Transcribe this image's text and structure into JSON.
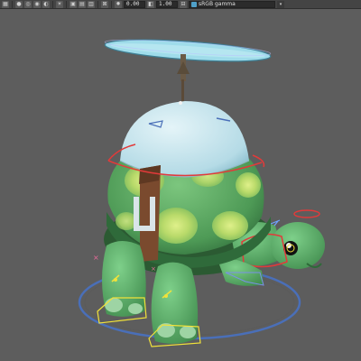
{
  "toolbar": {
    "icons": [
      "grid-icon",
      "camera-icon",
      "wireframe-icon",
      "shaded-icon",
      "textured-icon",
      "light-icon",
      "shadow-icon",
      "xray-icon",
      "isolate-icon",
      "gate-icon"
    ],
    "exposure_icon": "exposure-icon",
    "exposure_value": "0.00",
    "gamma_icon": "gamma-icon",
    "gamma_value": "1.00",
    "color_management": "sRGB gamma",
    "dropdown_glyph": "▾"
  },
  "viewport": {
    "background_color": "#5d5d5d",
    "grid_color": "#6c6c6c",
    "shell_top_color": "#bfe0ea",
    "shell_body_color": "#5fb06a",
    "spot_color": "#c6e07a",
    "strap_color": "#7a4a2e",
    "rotor_color": "#8fd4e6",
    "control_red": "#e23a3a",
    "control_blue": "#5a78c8",
    "control_yellow": "#f1e23a"
  }
}
